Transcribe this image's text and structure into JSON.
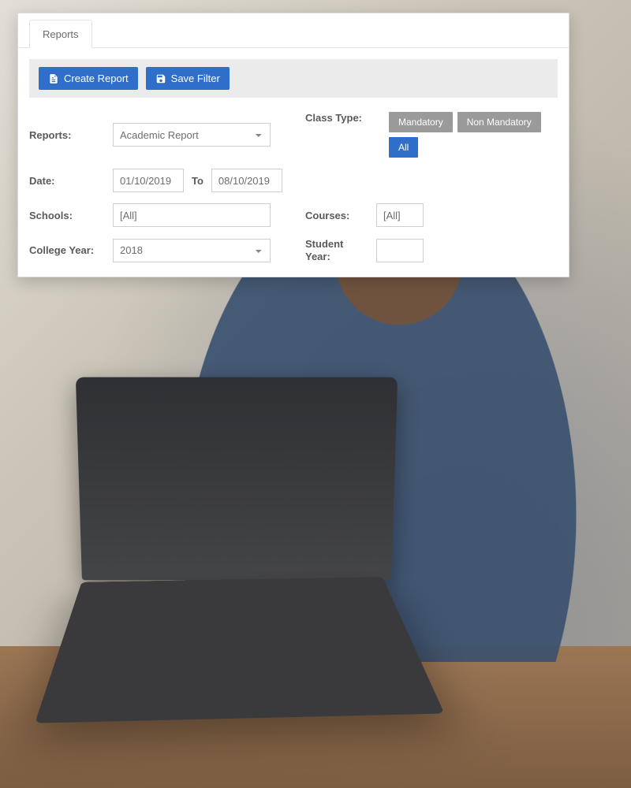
{
  "tab": {
    "label": "Reports"
  },
  "toolbar": {
    "create_report": "Create Report",
    "save_filter": "Save Filter"
  },
  "form": {
    "reports_label": "Reports:",
    "reports_value": "Academic Report",
    "date_label": "Date:",
    "date_from": "01/10/2019",
    "date_to_sep": "To",
    "date_to": "08/10/2019",
    "schools_label": "Schools:",
    "schools_value": "[All]",
    "college_year_label": "College Year:",
    "college_year_value": "2018",
    "class_type_label": "Class Type:",
    "class_type_options": {
      "mandatory": "Mandatory",
      "non_mandatory": "Non Mandatory",
      "all": "All"
    },
    "courses_label": "Courses:",
    "courses_value": "[All]",
    "student_year_label": "Student Year:",
    "student_year_value": ""
  }
}
